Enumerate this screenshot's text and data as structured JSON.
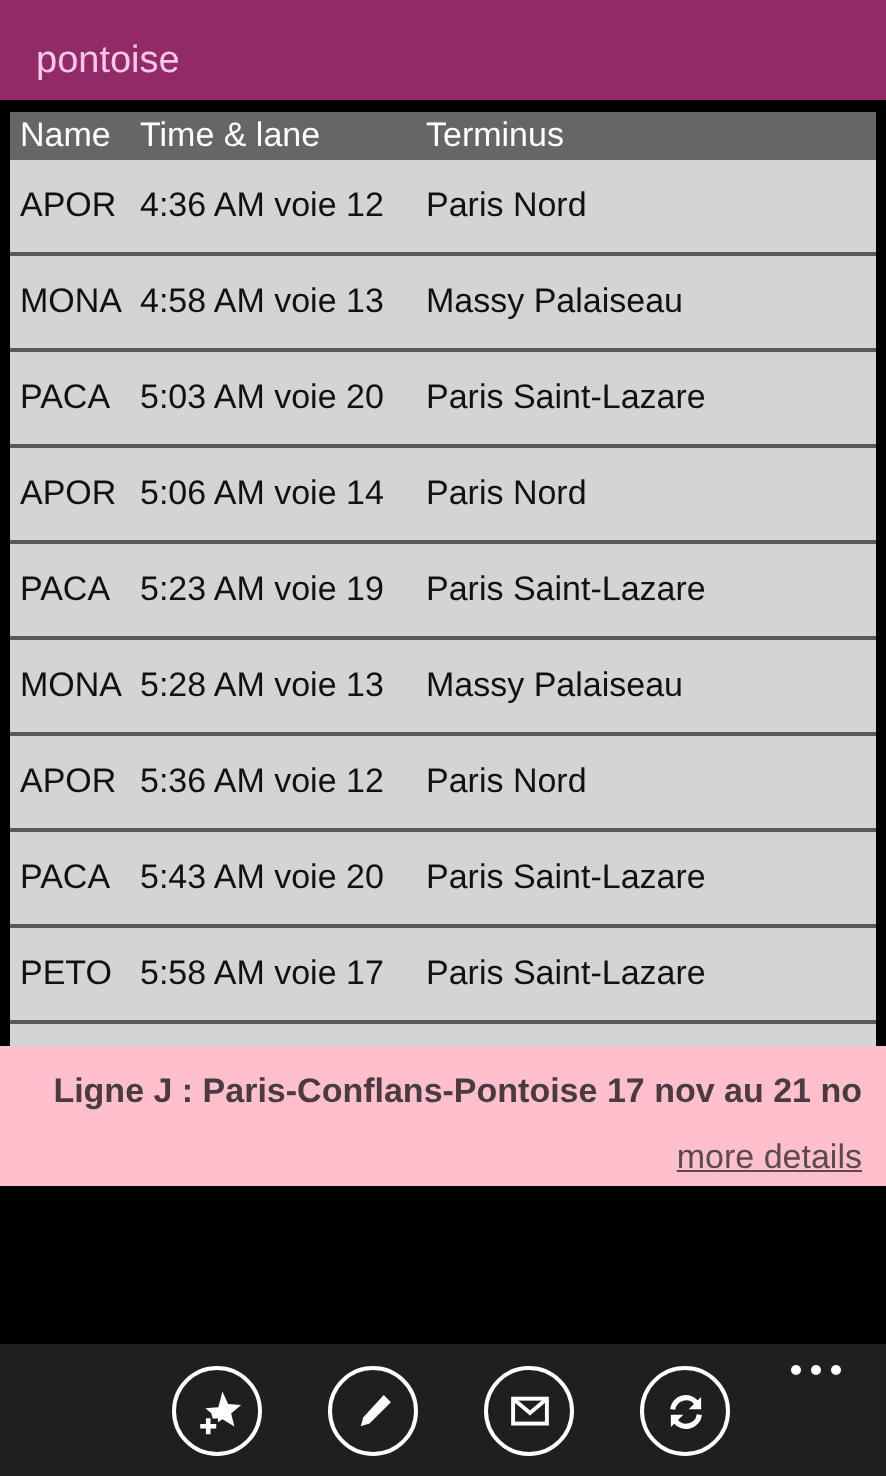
{
  "header": {
    "title": "pontoise"
  },
  "table": {
    "columns": [
      "Name",
      "Time & lane",
      "Terminus"
    ],
    "rows": [
      {
        "name": "APOR",
        "time": "4:36 AM voie 12",
        "terminus": "Paris Nord"
      },
      {
        "name": "MONA",
        "time": "4:58 AM voie 13",
        "terminus": "Massy Palaiseau"
      },
      {
        "name": "PACA",
        "time": "5:03 AM voie 20",
        "terminus": "Paris Saint-Lazare"
      },
      {
        "name": "APOR",
        "time": "5:06 AM voie 14",
        "terminus": "Paris Nord"
      },
      {
        "name": "PACA",
        "time": "5:23 AM voie 19",
        "terminus": "Paris Saint-Lazare"
      },
      {
        "name": "MONA",
        "time": "5:28 AM voie 13",
        "terminus": "Massy Palaiseau"
      },
      {
        "name": "APOR",
        "time": "5:36 AM voie 12",
        "terminus": "Paris Nord"
      },
      {
        "name": "PACA",
        "time": "5:43 AM voie 20",
        "terminus": "Paris Saint-Lazare"
      },
      {
        "name": "PETO",
        "time": "5:58 AM voie 17",
        "terminus": "Paris Saint-Lazare"
      }
    ]
  },
  "alert": {
    "message": "Ligne J : Paris-Conflans-Pontoise 17 nov au 21 no",
    "link": "more details"
  },
  "app_bar": {
    "buttons": [
      {
        "kind": "favorite"
      },
      {
        "kind": "edit"
      },
      {
        "kind": "mail"
      },
      {
        "kind": "refresh"
      }
    ]
  }
}
